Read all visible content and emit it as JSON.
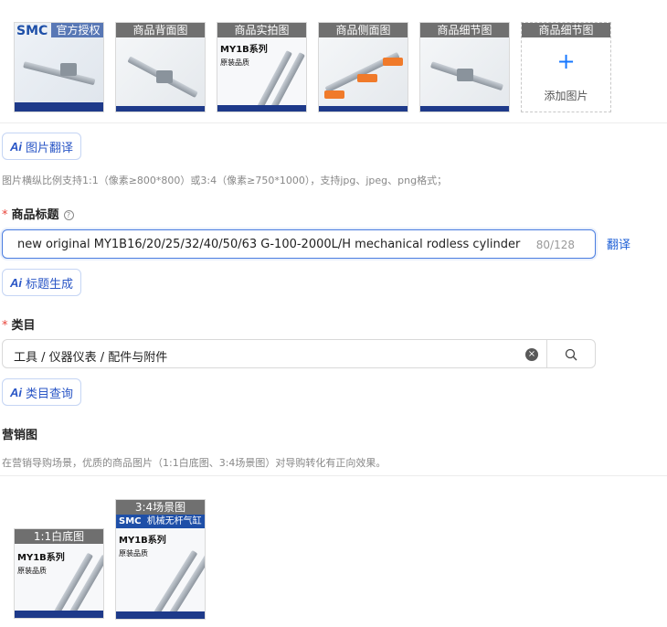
{
  "images": {
    "thumbs": [
      {
        "caption": "官方授权",
        "brand": "SMC"
      },
      {
        "caption": "商品背面图"
      },
      {
        "caption": "商品实拍图",
        "series": "MY1B系列",
        "sub": "原装品质"
      },
      {
        "caption": "商品侧面图"
      },
      {
        "caption": "商品细节图"
      }
    ],
    "add": {
      "caption": "商品细节图",
      "plus": "+",
      "label": "添加图片"
    }
  },
  "image_translate_button": {
    "ai": "Ai",
    "label": "图片翻译"
  },
  "image_hint": "图片横纵比例支持1:1（像素≥800*800）或3:4（像素≥750*1000），支持jpg、jpeg、png格式；",
  "title_field": {
    "required_mark": "*",
    "label": "商品标题",
    "help_icon": "?",
    "value": "new original MY1B16/20/25/32/40/50/63 G-100-2000L/H mechanical rodless cylinder",
    "counter": "80/128",
    "translate_link": "翻译"
  },
  "title_gen_button": {
    "ai": "Ai",
    "label": "标题生成"
  },
  "category_field": {
    "required_mark": "*",
    "label": "类目",
    "value": "工具 / 仪器仪表 / 配件与附件",
    "clear_icon": "×"
  },
  "category_query_button": {
    "ai": "Ai",
    "label": "类目查询"
  },
  "marketing": {
    "label": "营销图",
    "hint": "在营销导购场景，优质的商品图片（1:1白底图、3:4场景图）对导购转化有正向效果。",
    "thumbs": [
      {
        "caption": "1:1白底图",
        "series": "MY1B系列",
        "sub": "原装品质"
      },
      {
        "caption": "3:4场景图",
        "brand": "SMC",
        "brand_sub": "机械无杆气缸",
        "series": "MY1B系列",
        "sub": "原装品质"
      }
    ]
  },
  "colors": {
    "accent": "#1677ff",
    "ai_blue": "#2a56c6",
    "required": "#e8443a",
    "border": "#d9d9d9"
  }
}
